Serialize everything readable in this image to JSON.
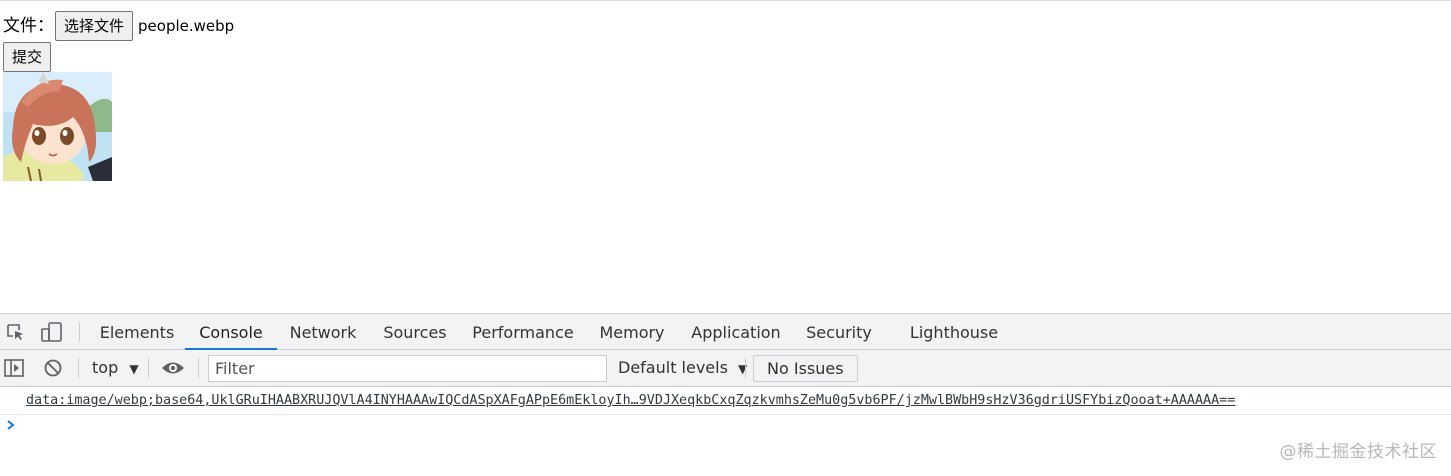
{
  "page": {
    "file_label": "文件：",
    "choose_file_button": "选择文件",
    "file_name": "people.webp",
    "submit_button": "提交"
  },
  "devtools": {
    "tabs": [
      {
        "label": "Elements",
        "active": false
      },
      {
        "label": "Console",
        "active": true
      },
      {
        "label": "Network",
        "active": false
      },
      {
        "label": "Sources",
        "active": false
      },
      {
        "label": "Performance",
        "active": false
      },
      {
        "label": "Memory",
        "active": false
      },
      {
        "label": "Application",
        "active": false
      },
      {
        "label": "Security",
        "active": false
      },
      {
        "label": "Lighthouse",
        "active": false
      }
    ],
    "context": "top",
    "filter_placeholder": "Filter",
    "levels": "Default levels",
    "issues": "No Issues",
    "log": "data:image/webp;base64,UklGRuIHAABXRUJQVlA4INYHAAAwIQCdASpXAFgAPpE6mEkloyIh…9VDJXeqkbCxqZqzkvmhsZeMu0g5vb6PF/jzMwlBWbH9sHzV36gdriUSFYbizQooat+AAAAAA=="
  },
  "watermark": "@稀土掘金技术社区",
  "colors": {
    "accent": "#1a73e8",
    "toolbar_bg": "#f1f3f4",
    "border": "#cacdd1"
  }
}
